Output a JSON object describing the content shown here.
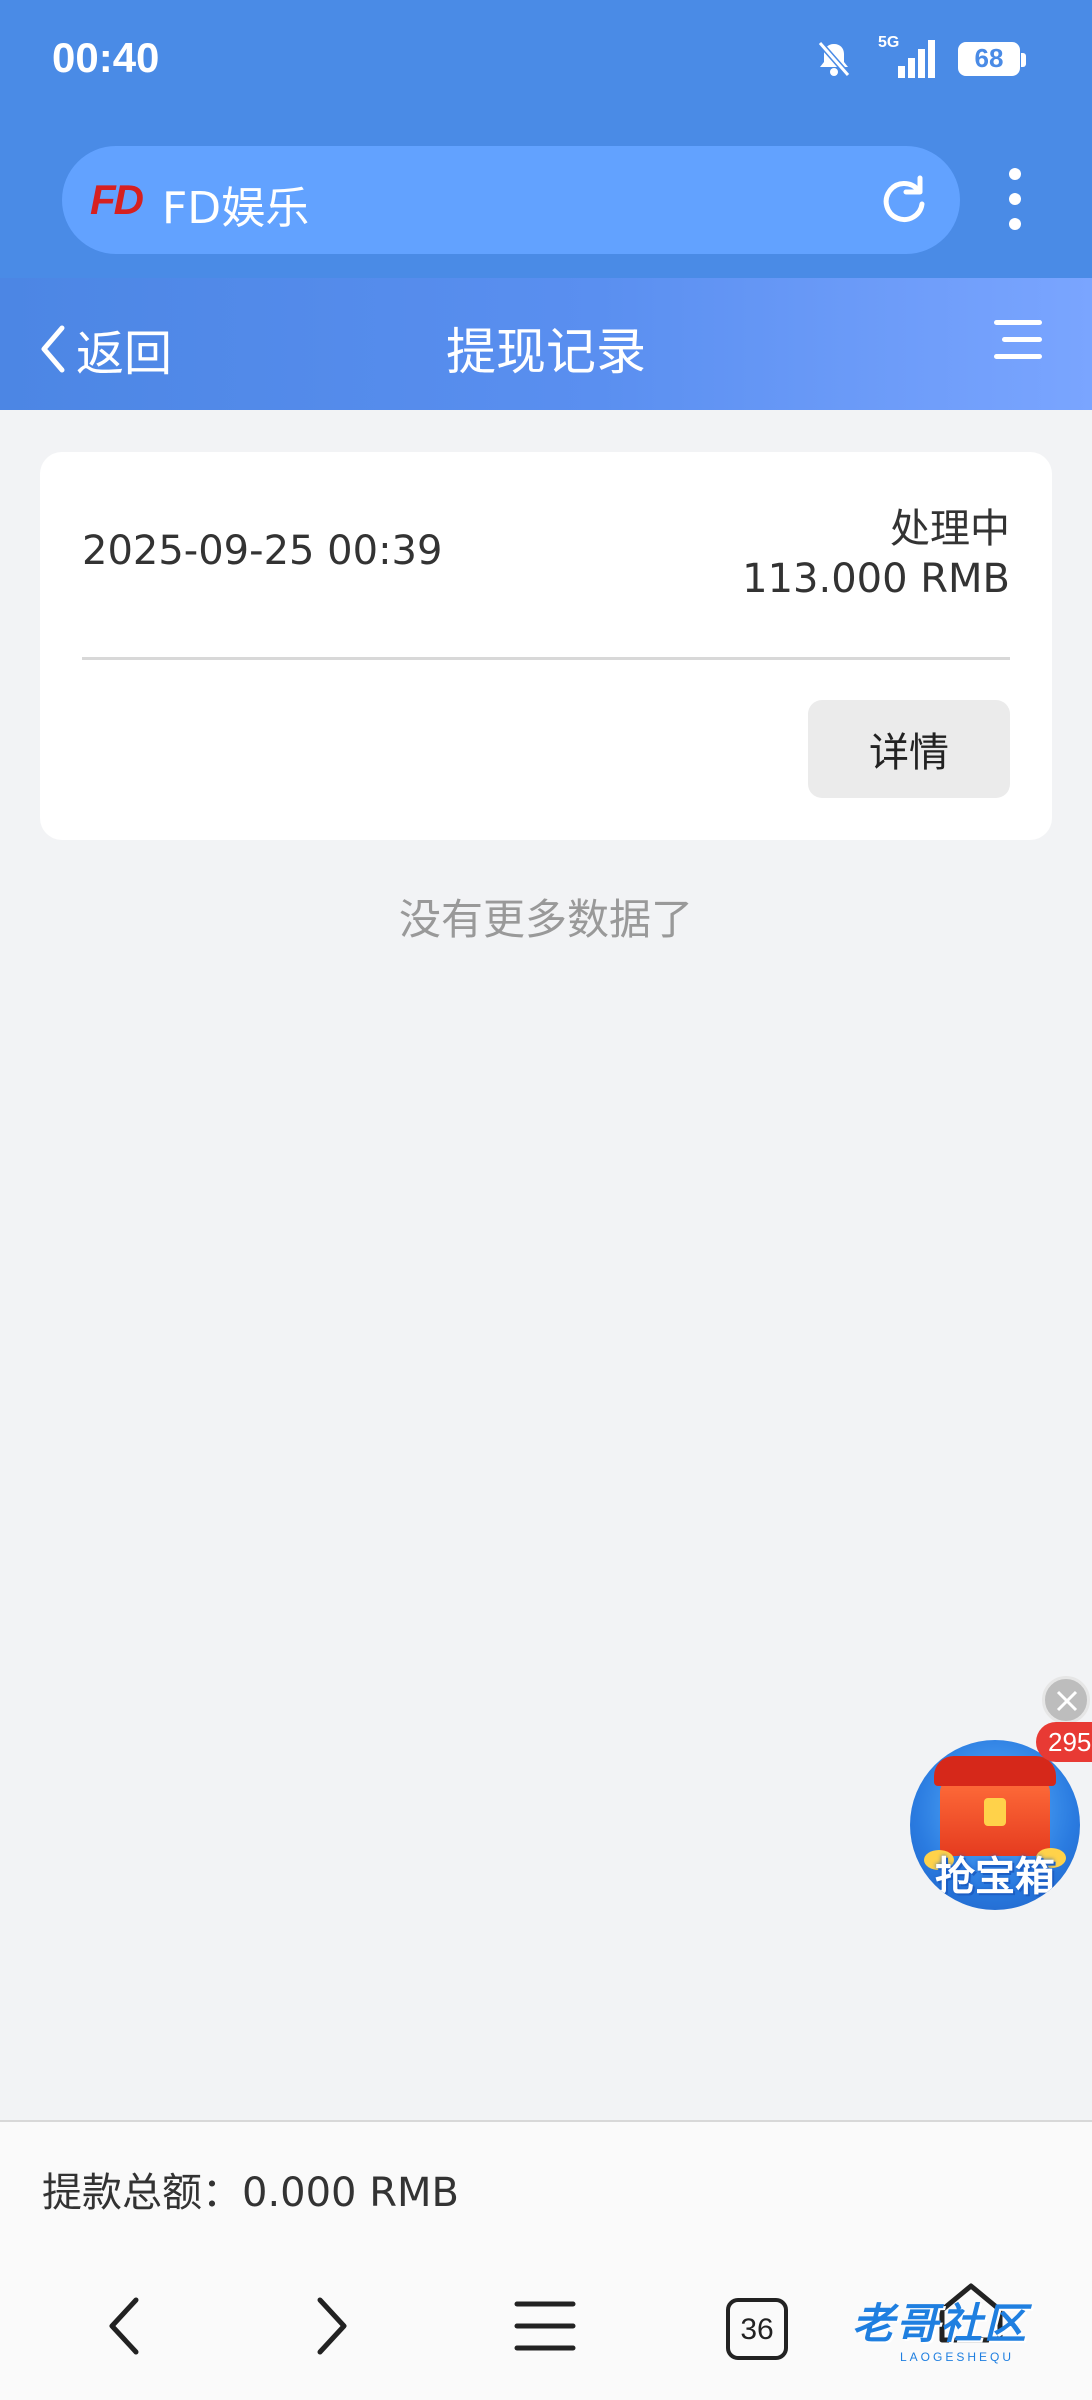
{
  "status_bar": {
    "time": "00:40",
    "network": "5G",
    "battery": "68"
  },
  "browser": {
    "site_logo": "FD",
    "site_name": "FD娱乐"
  },
  "header": {
    "back_label": "返回",
    "title": "提现记录"
  },
  "records": [
    {
      "datetime": "2025-09-25 00:39",
      "status": "处理中",
      "amount": "113.000 RMB",
      "detail_label": "详情"
    }
  ],
  "list_end_text": "没有更多数据了",
  "floating": {
    "label": "抢宝箱",
    "badge": "295"
  },
  "footer": {
    "total_label": "提款总额：0.000 RMB"
  },
  "bottom_bar": {
    "tabs_count": "36",
    "watermark": "老哥社区",
    "watermark_sub": "LAOGESHEQU"
  }
}
